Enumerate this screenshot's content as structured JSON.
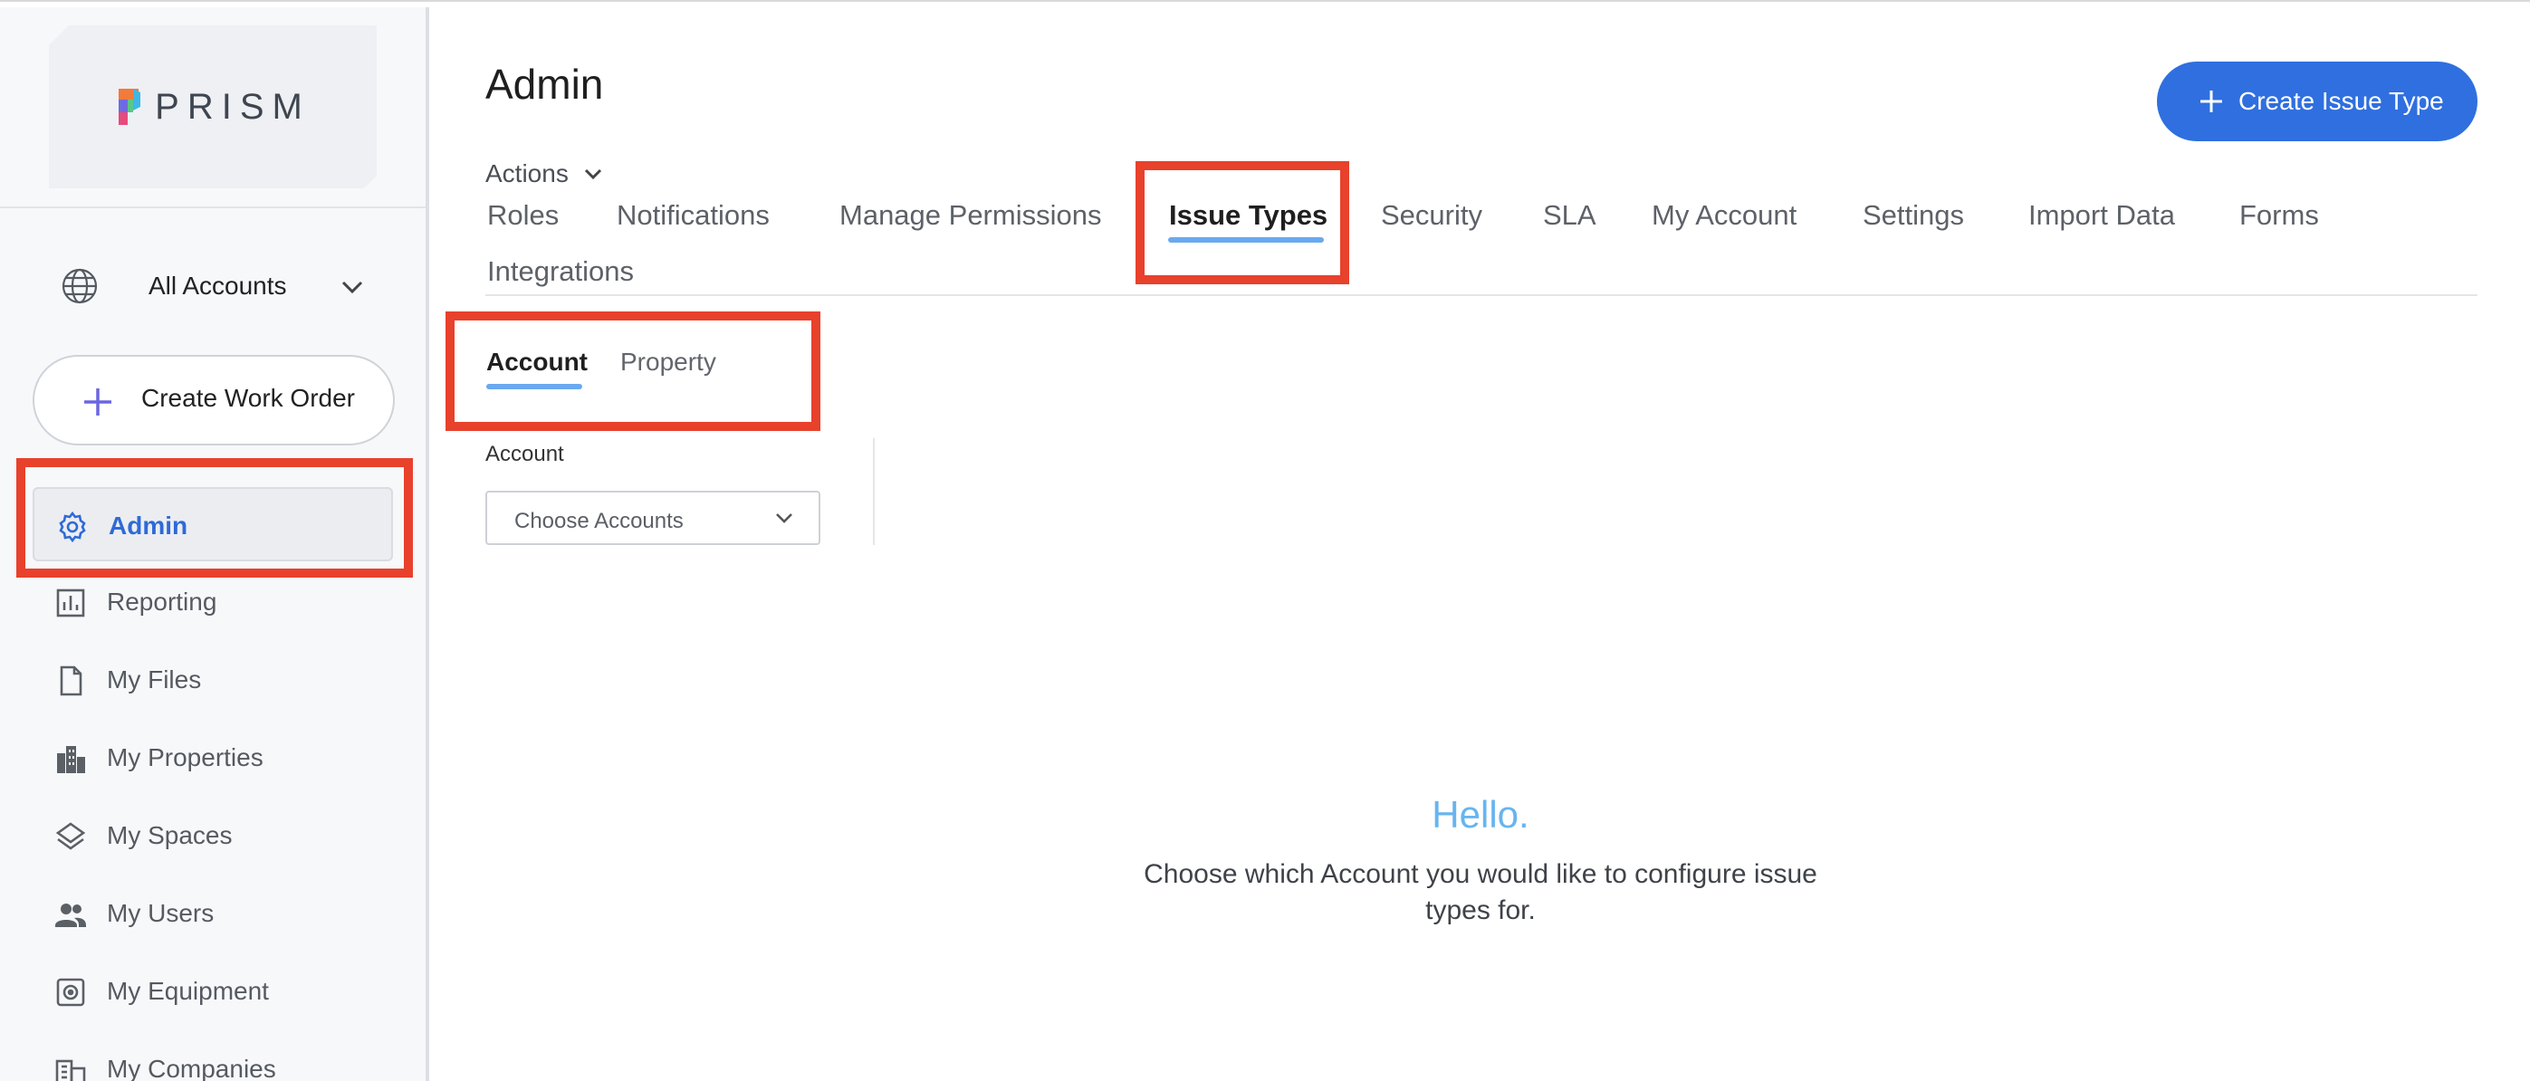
{
  "app": {
    "logo_text": "PRISM"
  },
  "sidebar": {
    "account_selector": "All Accounts",
    "create_work_order": "Create Work Order",
    "items": [
      {
        "label": "Admin",
        "icon": "gear-icon",
        "active": true
      },
      {
        "label": "Reporting",
        "icon": "chart-icon",
        "active": false
      },
      {
        "label": "My Files",
        "icon": "file-icon",
        "active": false
      },
      {
        "label": "My Properties",
        "icon": "building-icon",
        "active": false
      },
      {
        "label": "My Spaces",
        "icon": "layers-icon",
        "active": false
      },
      {
        "label": "My Users",
        "icon": "users-icon",
        "active": false
      },
      {
        "label": "My Equipment",
        "icon": "equipment-icon",
        "active": false
      },
      {
        "label": "My Companies",
        "icon": "company-icon",
        "active": false
      }
    ]
  },
  "header": {
    "title": "Admin",
    "actions_label": "Actions",
    "create_button": "Create Issue Type"
  },
  "tabs": [
    "Roles",
    "Notifications",
    "Manage Permissions",
    "Issue Types",
    "Security",
    "SLA",
    "My Account",
    "Settings",
    "Import Data",
    "Forms",
    "Integrations"
  ],
  "active_tab": "Issue Types",
  "subtabs": [
    "Account",
    "Property"
  ],
  "active_subtab": "Account",
  "filter": {
    "label": "Account",
    "placeholder": "Choose Accounts"
  },
  "empty_state": {
    "heading": "Hello.",
    "message": "Choose which Account you would like to configure issue types for."
  },
  "colors": {
    "accent": "#2f6fdf",
    "highlight": "#e8412c",
    "tab_underline": "#6aa9ef",
    "hello": "#67b5ef"
  }
}
